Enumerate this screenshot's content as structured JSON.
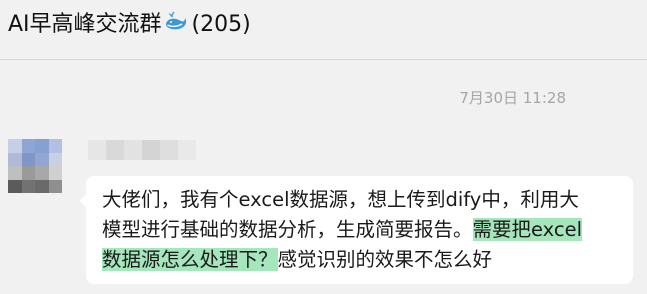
{
  "header": {
    "title": "AI早高峰交流群",
    "title_icon": "whale-icon",
    "member_count": "(205)"
  },
  "chat": {
    "timestamp": "7月30日 11:28",
    "message": {
      "line1": "大佬们，我有个excel数据源，想上传到dify中，利用大",
      "line2_plain": "模型进行基础的数据分析，生成简要报告。",
      "line2_highlight": "需要把excel",
      "line3_highlight": "数据源怎么处理下？",
      "line3_plain": "感觉识别的效果不怎么好"
    }
  },
  "colors": {
    "background": "#f1f1f1",
    "bubble": "#ffffff",
    "highlight": "#a6e6bd",
    "timestamp": "#a6a6a6"
  }
}
